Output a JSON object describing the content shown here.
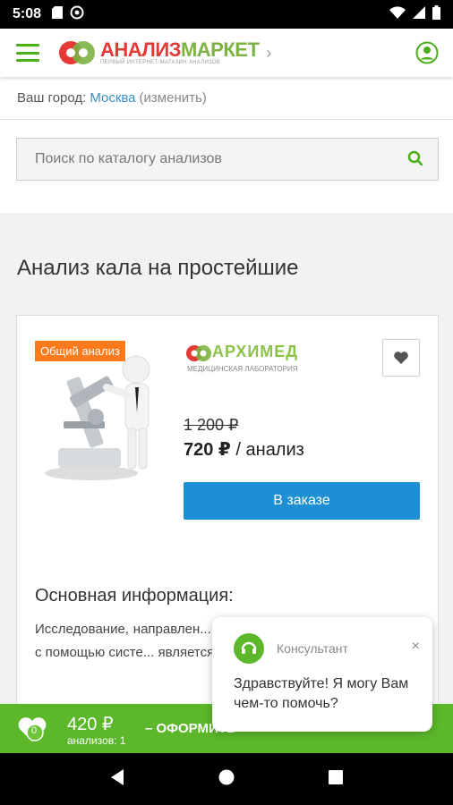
{
  "status_bar": {
    "time": "5:08"
  },
  "header": {
    "logo_main_red": "АНАЛИЗ",
    "logo_main_green": "МАРКЕТ",
    "logo_sub": "ПЕРВЫЙ ИНТЕРНЕТ-МАГАЗИН АНАЛИЗОВ",
    "chevron": "›"
  },
  "city": {
    "label": "Ваш город:",
    "value": "Москва",
    "change": "(изменить)"
  },
  "search": {
    "placeholder": "Поиск по каталогу анализов"
  },
  "page": {
    "title": "Анализ кала на простейшие"
  },
  "product": {
    "badge": "Общий анализ",
    "lab_name": "АРХИМЕД",
    "lab_sub": "МЕДИЦИНСКАЯ ЛАБОРАТОРИЯ",
    "old_price": "1 200 ₽",
    "new_price": "720 ₽",
    "price_unit": "/ анализ",
    "order_label": "В заказе",
    "info_title": "Основная информация:",
    "info_text": "Исследование, направлен... обитающих в нижних о... тракта, с помощью систе... является выявление ц..."
  },
  "chat": {
    "name": "Консультант",
    "close": "×",
    "message": "Здравствуйте! Я могу Вам чем-то помочь?"
  },
  "cart": {
    "count_badge": "0",
    "sum": "420 ₽",
    "count_label": "анализов: 1",
    "checkout": "– ОФОРМИТЬ"
  },
  "colors": {
    "green": "#5cb82a",
    "blue": "#1e8fd4",
    "orange": "#ff7a1a",
    "red": "#e53935"
  }
}
